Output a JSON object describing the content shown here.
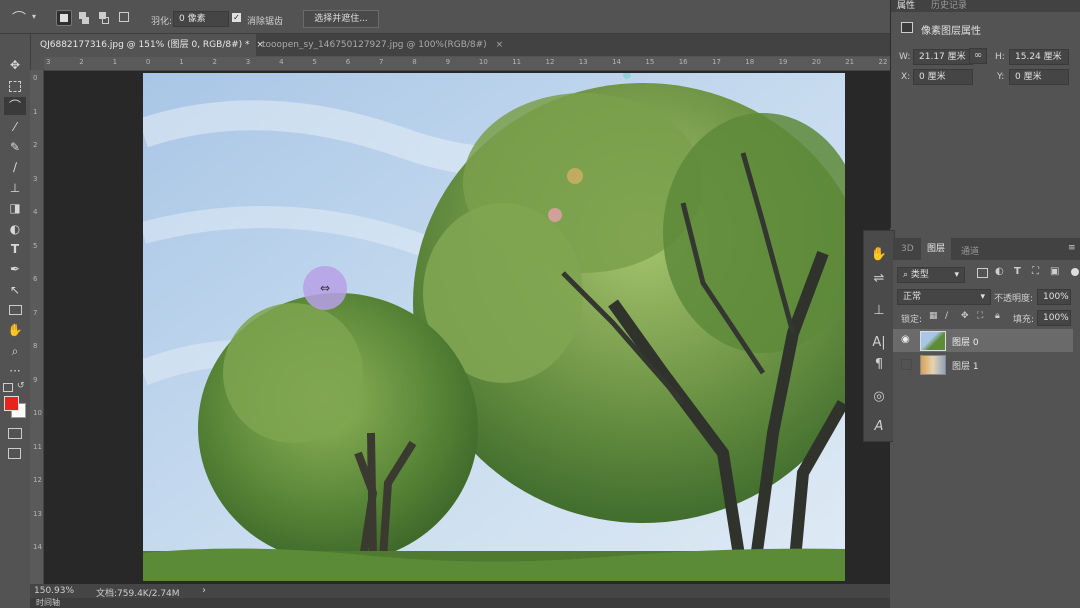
{
  "options_bar": {
    "feather_label": "羽化:",
    "feather_value": "0 像素",
    "antialias_label": "消除锯齿",
    "select_mask_button": "选择并遮住..."
  },
  "tabs": [
    {
      "label": "QJ6882177316.jpg @ 151% (图层 0, RGB/8#) *",
      "close": "×"
    },
    {
      "label": "tooopen_sy_146750127927.jpg @ 100%(RGB/8#)",
      "close": "×"
    }
  ],
  "hruler_ticks": [
    "3",
    "2",
    "1",
    "0",
    "1",
    "2",
    "3",
    "4",
    "5",
    "6",
    "7",
    "8",
    "9",
    "10",
    "11",
    "12",
    "13",
    "14",
    "15",
    "16",
    "17",
    "18",
    "19",
    "20",
    "21",
    "22"
  ],
  "vruler_ticks": [
    "0",
    "1",
    "2",
    "3",
    "4",
    "5",
    "6",
    "7",
    "8",
    "9",
    "1\n0",
    "1\n1",
    "1\n2",
    "1\n3",
    "1\n4"
  ],
  "status": {
    "zoom": "150.93%",
    "doc": "文档:759.4K/2.74M",
    "arrow": "›"
  },
  "bottom_tab": "时间轴",
  "properties": {
    "tab1": "属性",
    "tab2": "历史记录",
    "title": "像素图层属性",
    "w_label": "W:",
    "w_value": "21.17 厘米",
    "h_label": "H:",
    "h_value": "15.24 厘米",
    "x_label": "X:",
    "x_value": "0 厘米",
    "y_label": "Y:",
    "y_value": "0 厘米"
  },
  "layers_panel": {
    "tabs": [
      "3D",
      "图层",
      "通道"
    ],
    "filter_label": "类型",
    "blend_mode": "正常",
    "opacity_label": "不透明度:",
    "opacity_value": "100%",
    "lock_label": "锁定:",
    "fill_label": "填充:",
    "fill_value": "100%",
    "layers": [
      {
        "name": "图层 0",
        "visible": true,
        "selected": true
      },
      {
        "name": "图层 1",
        "visible": false,
        "selected": false
      }
    ]
  },
  "colors": {
    "foreground": "#e8231e",
    "background": "#ffffff",
    "panel": "#535353",
    "selected_layer": "#6a6a6a"
  }
}
